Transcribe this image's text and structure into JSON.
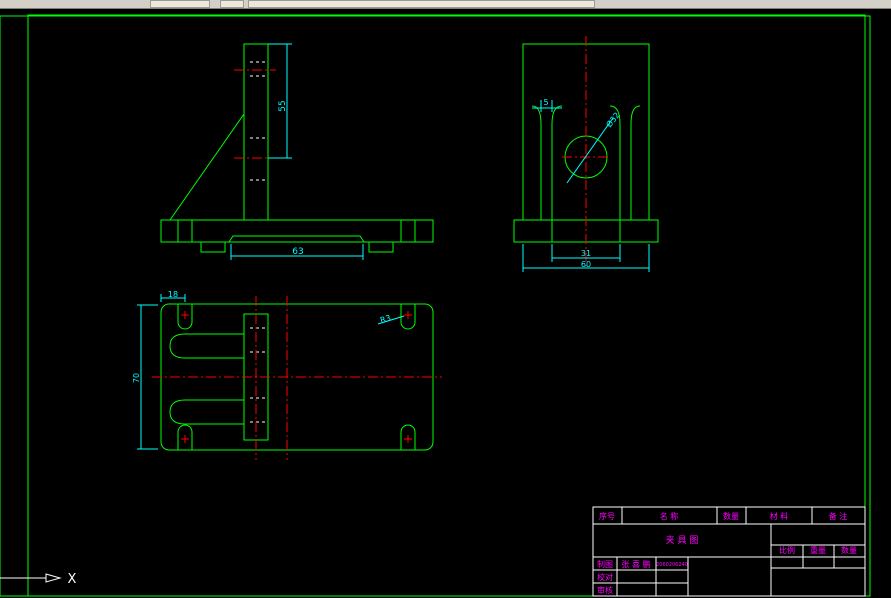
{
  "colors": {
    "background": "#000000",
    "outline": "#00ff00",
    "centerline": "#ff0000",
    "dimension": "#00ffff",
    "hidden": "#ffffff",
    "title_text": "#ff00ff",
    "frame": "#00ff00"
  },
  "dimensions": {
    "front_height": "55",
    "front_base": "63",
    "side_slot": "5",
    "side_hole": "Ø32",
    "side_inner": "31",
    "side_width": "60",
    "top_slot": "18",
    "top_radius": "R3",
    "top_depth": "70"
  },
  "title_block": {
    "header": [
      "序号",
      "名  称",
      "数量",
      "材  料",
      "备 注"
    ],
    "title": "夹   具   图",
    "props": [
      "比例",
      "重量",
      "数量"
    ],
    "rows": [
      "制图",
      "校对",
      "审核"
    ],
    "drawer": "张 喜 鹏",
    "drawer_sub": "2060206240"
  },
  "ucs": {
    "axis_label": "X"
  }
}
